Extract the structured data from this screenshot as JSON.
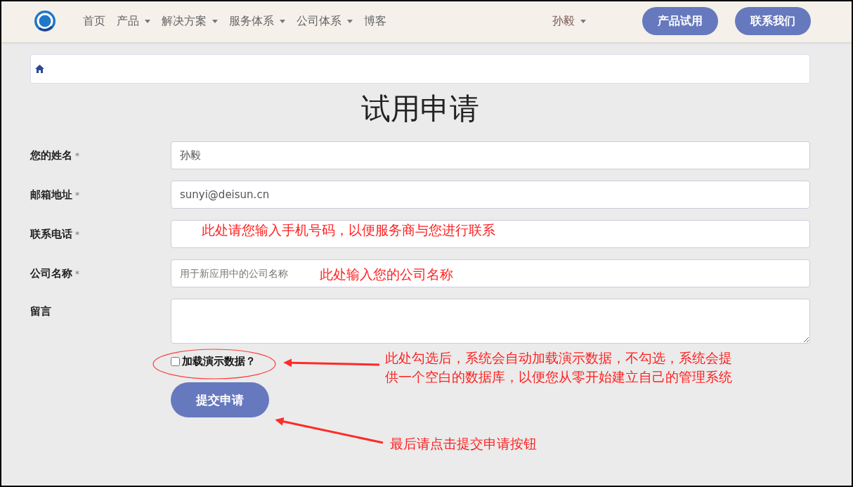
{
  "nav": {
    "items": [
      {
        "label": "首页",
        "has_dropdown": false
      },
      {
        "label": "产品",
        "has_dropdown": true
      },
      {
        "label": "解决方案",
        "has_dropdown": true
      },
      {
        "label": "服务体系",
        "has_dropdown": true
      },
      {
        "label": "公司体系",
        "has_dropdown": true
      },
      {
        "label": "博客",
        "has_dropdown": false
      }
    ],
    "user": {
      "label": "孙毅",
      "has_dropdown": true
    },
    "buttons": [
      "产品试用",
      "联系我们"
    ]
  },
  "title": "试用申请",
  "form": {
    "fields": [
      {
        "label": "您的姓名",
        "required_mark": "*",
        "kind": "input",
        "value": "孙毅"
      },
      {
        "label": "邮箱地址",
        "required_mark": "*",
        "kind": "input",
        "value": "sunyi@deisun.cn"
      },
      {
        "label": "联系电话",
        "required_mark": "*",
        "kind": "input"
      },
      {
        "label": "公司名称",
        "required_mark": "*",
        "kind": "input",
        "placeholder": "用于新应用中的公司名称"
      },
      {
        "label": "留言",
        "kind": "textarea"
      }
    ],
    "checkbox": {
      "label": "加载演示数据？",
      "checked": false
    },
    "submit": "提交申请"
  },
  "annotations": [
    {
      "kind": "text",
      "text": "此处请您输入手机号码，以便服务商与您进行联系"
    },
    {
      "kind": "text",
      "text": "此处输入您的公司名称"
    },
    {
      "kind": "ellipse"
    },
    {
      "kind": "arrow"
    },
    {
      "kind": "text",
      "text": "此处勾选后，系统会自动加载演示数据，不勾选，系统会提供一个空白的数据库，以便您从零开始建立自己的管理系统"
    },
    {
      "kind": "arrow"
    },
    {
      "kind": "text",
      "text": "最后请点击提交申请按钮"
    }
  ]
}
